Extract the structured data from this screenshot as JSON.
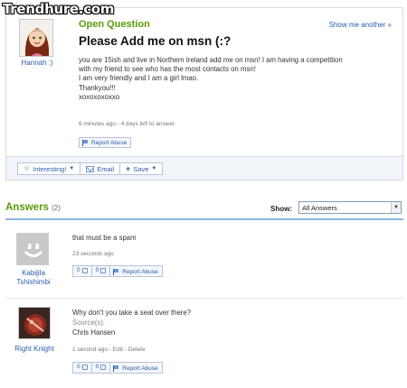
{
  "watermark": "Trendhure.com",
  "question": {
    "status": "Open Question",
    "show_another": "Show me another »",
    "asker": "Hannah :)",
    "title": "Please Add me on msn (:?",
    "body": [
      "you are 15ish and live in Northern Ireland add me on msn! I am having a competition",
      "with my friend to see who has the most contacts on msn!",
      "I am very friendly and I am a girl lmao.",
      "Thankyou!!!",
      "xoxoxoxoxxo"
    ],
    "meta": "6 minutes ago - 4 days left to answer.",
    "report": "Report Abuse"
  },
  "actions": {
    "interesting": "Interesting!",
    "email": "Email",
    "save": "Save"
  },
  "answers": {
    "heading": "Answers",
    "count": "(2)",
    "show_label": "Show:",
    "show_value": "All Answers",
    "items": [
      {
        "author_line1": "Kabijila",
        "author_line2": "Tshishimbi",
        "text": "that must be a spam",
        "meta": "23 seconds ago",
        "up": "0",
        "down": "0",
        "report": "Report Abuse"
      },
      {
        "author_line1": "Right Knight",
        "text": "Why don't you take a seat over there?",
        "source_label": "Source(s):",
        "source": "Chris Hansen",
        "meta": "1 second ago - Edit - Delete",
        "up": "0",
        "down": "0",
        "report": "Report Abuse"
      }
    ]
  },
  "colors": {
    "green_heading": "#5a9b0b",
    "link_blue": "#2b5ea7",
    "rule_blue": "#8fb5e0"
  }
}
